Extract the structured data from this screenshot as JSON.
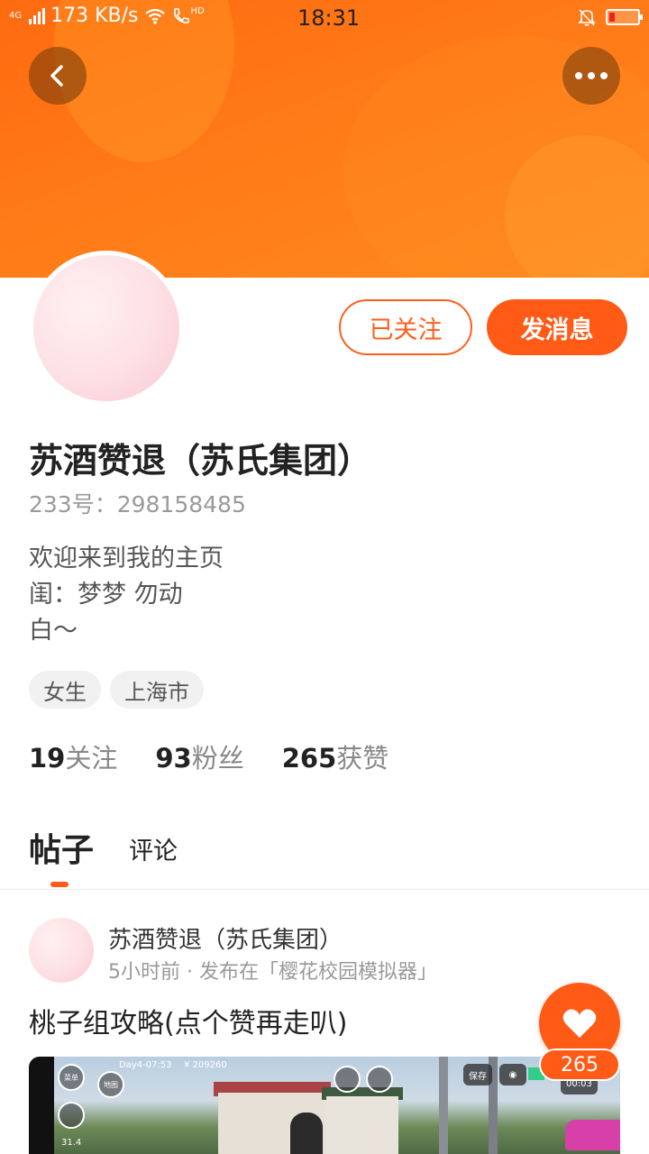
{
  "status_bar": {
    "network": "4G",
    "speed": "173 KB/s",
    "call_badge": "HD",
    "time": "18:31"
  },
  "profile": {
    "name": "苏酒赞退（苏氏集团）",
    "uid": "233号：298158485",
    "bio": [
      "欢迎来到我的主页",
      "闺：梦梦 勿动",
      "白～"
    ],
    "tags": [
      "女生",
      "上海市"
    ],
    "stats": [
      {
        "value": "19",
        "label": "关注"
      },
      {
        "value": "93",
        "label": "粉丝"
      },
      {
        "value": "265",
        "label": "获赞"
      }
    ]
  },
  "actions": {
    "follow_label": "已关注",
    "message_label": "发消息"
  },
  "tabs": [
    {
      "label": "帖子",
      "active": true
    },
    {
      "label": "评论",
      "active": false
    }
  ],
  "post": {
    "author": "苏酒赞退（苏氏集团）",
    "meta": "5小时前 · 发布在「樱花校园模拟器」",
    "title": "桃子组攻略(点个赞再走叭)",
    "image_hud": {
      "day_time": "Day4-07:53",
      "money": "¥ 209260",
      "menu": "菜单",
      "map": "地图",
      "save": "保存",
      "timer": "00:03",
      "stat": "31.4"
    },
    "like_count": "265"
  },
  "colors": {
    "accent": "#ff5a16",
    "banner": "#ff7a18"
  },
  "icons": {
    "back": "chevron-left-icon",
    "more": "more-dots-icon",
    "like": "heart-icon"
  }
}
